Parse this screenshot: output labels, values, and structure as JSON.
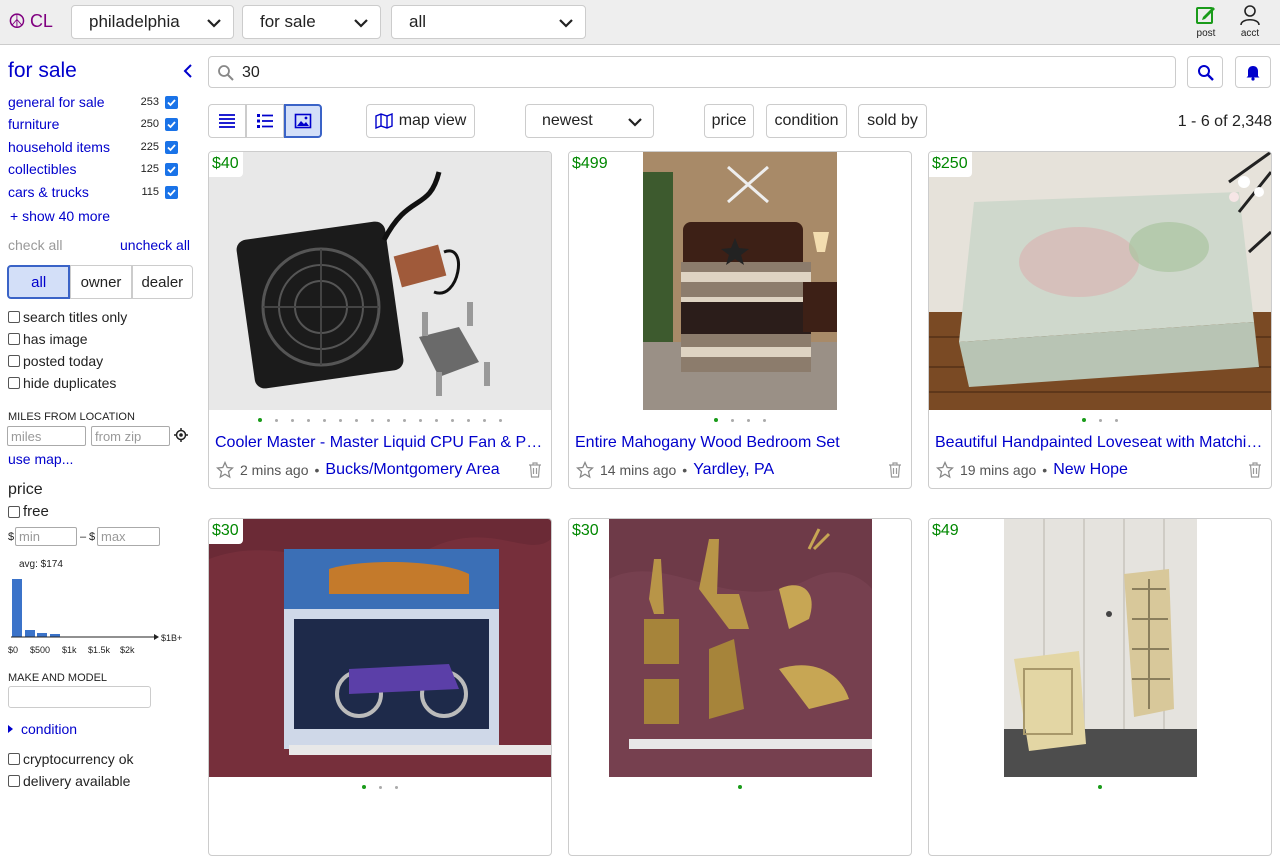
{
  "header": {
    "logo_text": "CL",
    "city": "philadelphia",
    "category": "for sale",
    "subcategory": "all",
    "post_label": "post",
    "acct_label": "acct",
    "accent": "#800080"
  },
  "sidebar": {
    "title": "for sale",
    "categories": [
      {
        "name": "general for sale",
        "count": "253"
      },
      {
        "name": "furniture",
        "count": "250"
      },
      {
        "name": "household items",
        "count": "225"
      },
      {
        "name": "collectibles",
        "count": "125"
      },
      {
        "name": "cars & trucks",
        "count": "115"
      }
    ],
    "show_more": "+ show 40 more",
    "check_all": "check all",
    "uncheck_all": "uncheck all",
    "seller": [
      "all",
      "owner",
      "dealer"
    ],
    "options": [
      "search titles only",
      "has image",
      "posted today",
      "hide duplicates"
    ],
    "miles_label": "MILES FROM LOCATION",
    "miles_placeholder": "miles",
    "zip_placeholder": "from zip",
    "use_map": "use map...",
    "price_label": "price",
    "free_label": "free",
    "min_placeholder": "min",
    "max_placeholder": "max",
    "currency": "$",
    "dash": "–",
    "hist": {
      "avg": "avg: $174",
      "ticks": [
        "$0",
        "$500",
        "$1k",
        "$1.5k",
        "$2k",
        "$1B+"
      ],
      "bar_heights": [
        1.0,
        0.12,
        0.06,
        0.04
      ]
    },
    "make_model_label": "MAKE AND MODEL",
    "condition_label": "condition",
    "extra_options": [
      "cryptocurrency ok",
      "delivery available"
    ]
  },
  "search": {
    "query": "30"
  },
  "toolbar": {
    "map_view": "map view",
    "sort": "newest",
    "filters": [
      "price",
      "condition",
      "sold by"
    ],
    "count": "1 - 6 of 2,348"
  },
  "listings": [
    {
      "price": "$40",
      "title": "Cooler Master - Master Liquid CPU Fan & Pump",
      "time": "2 mins ago",
      "location": "Bucks/Montgomery Area",
      "images": 16
    },
    {
      "price": "$499",
      "title": "Entire Mahogany Wood Bedroom Set",
      "time": "14 mins ago",
      "location": "Yardley, PA",
      "images": 4
    },
    {
      "price": "$250",
      "title": "Beautiful Handpainted Loveseat with Matching Table",
      "time": "19 mins ago",
      "location": "New Hope",
      "images": 3
    },
    {
      "price": "$30",
      "title": "",
      "time": "",
      "location": "",
      "images": 3
    },
    {
      "price": "$30",
      "title": "",
      "time": "",
      "location": "",
      "images": 1
    },
    {
      "price": "$49",
      "title": "",
      "time": "",
      "location": "",
      "images": 1
    }
  ]
}
